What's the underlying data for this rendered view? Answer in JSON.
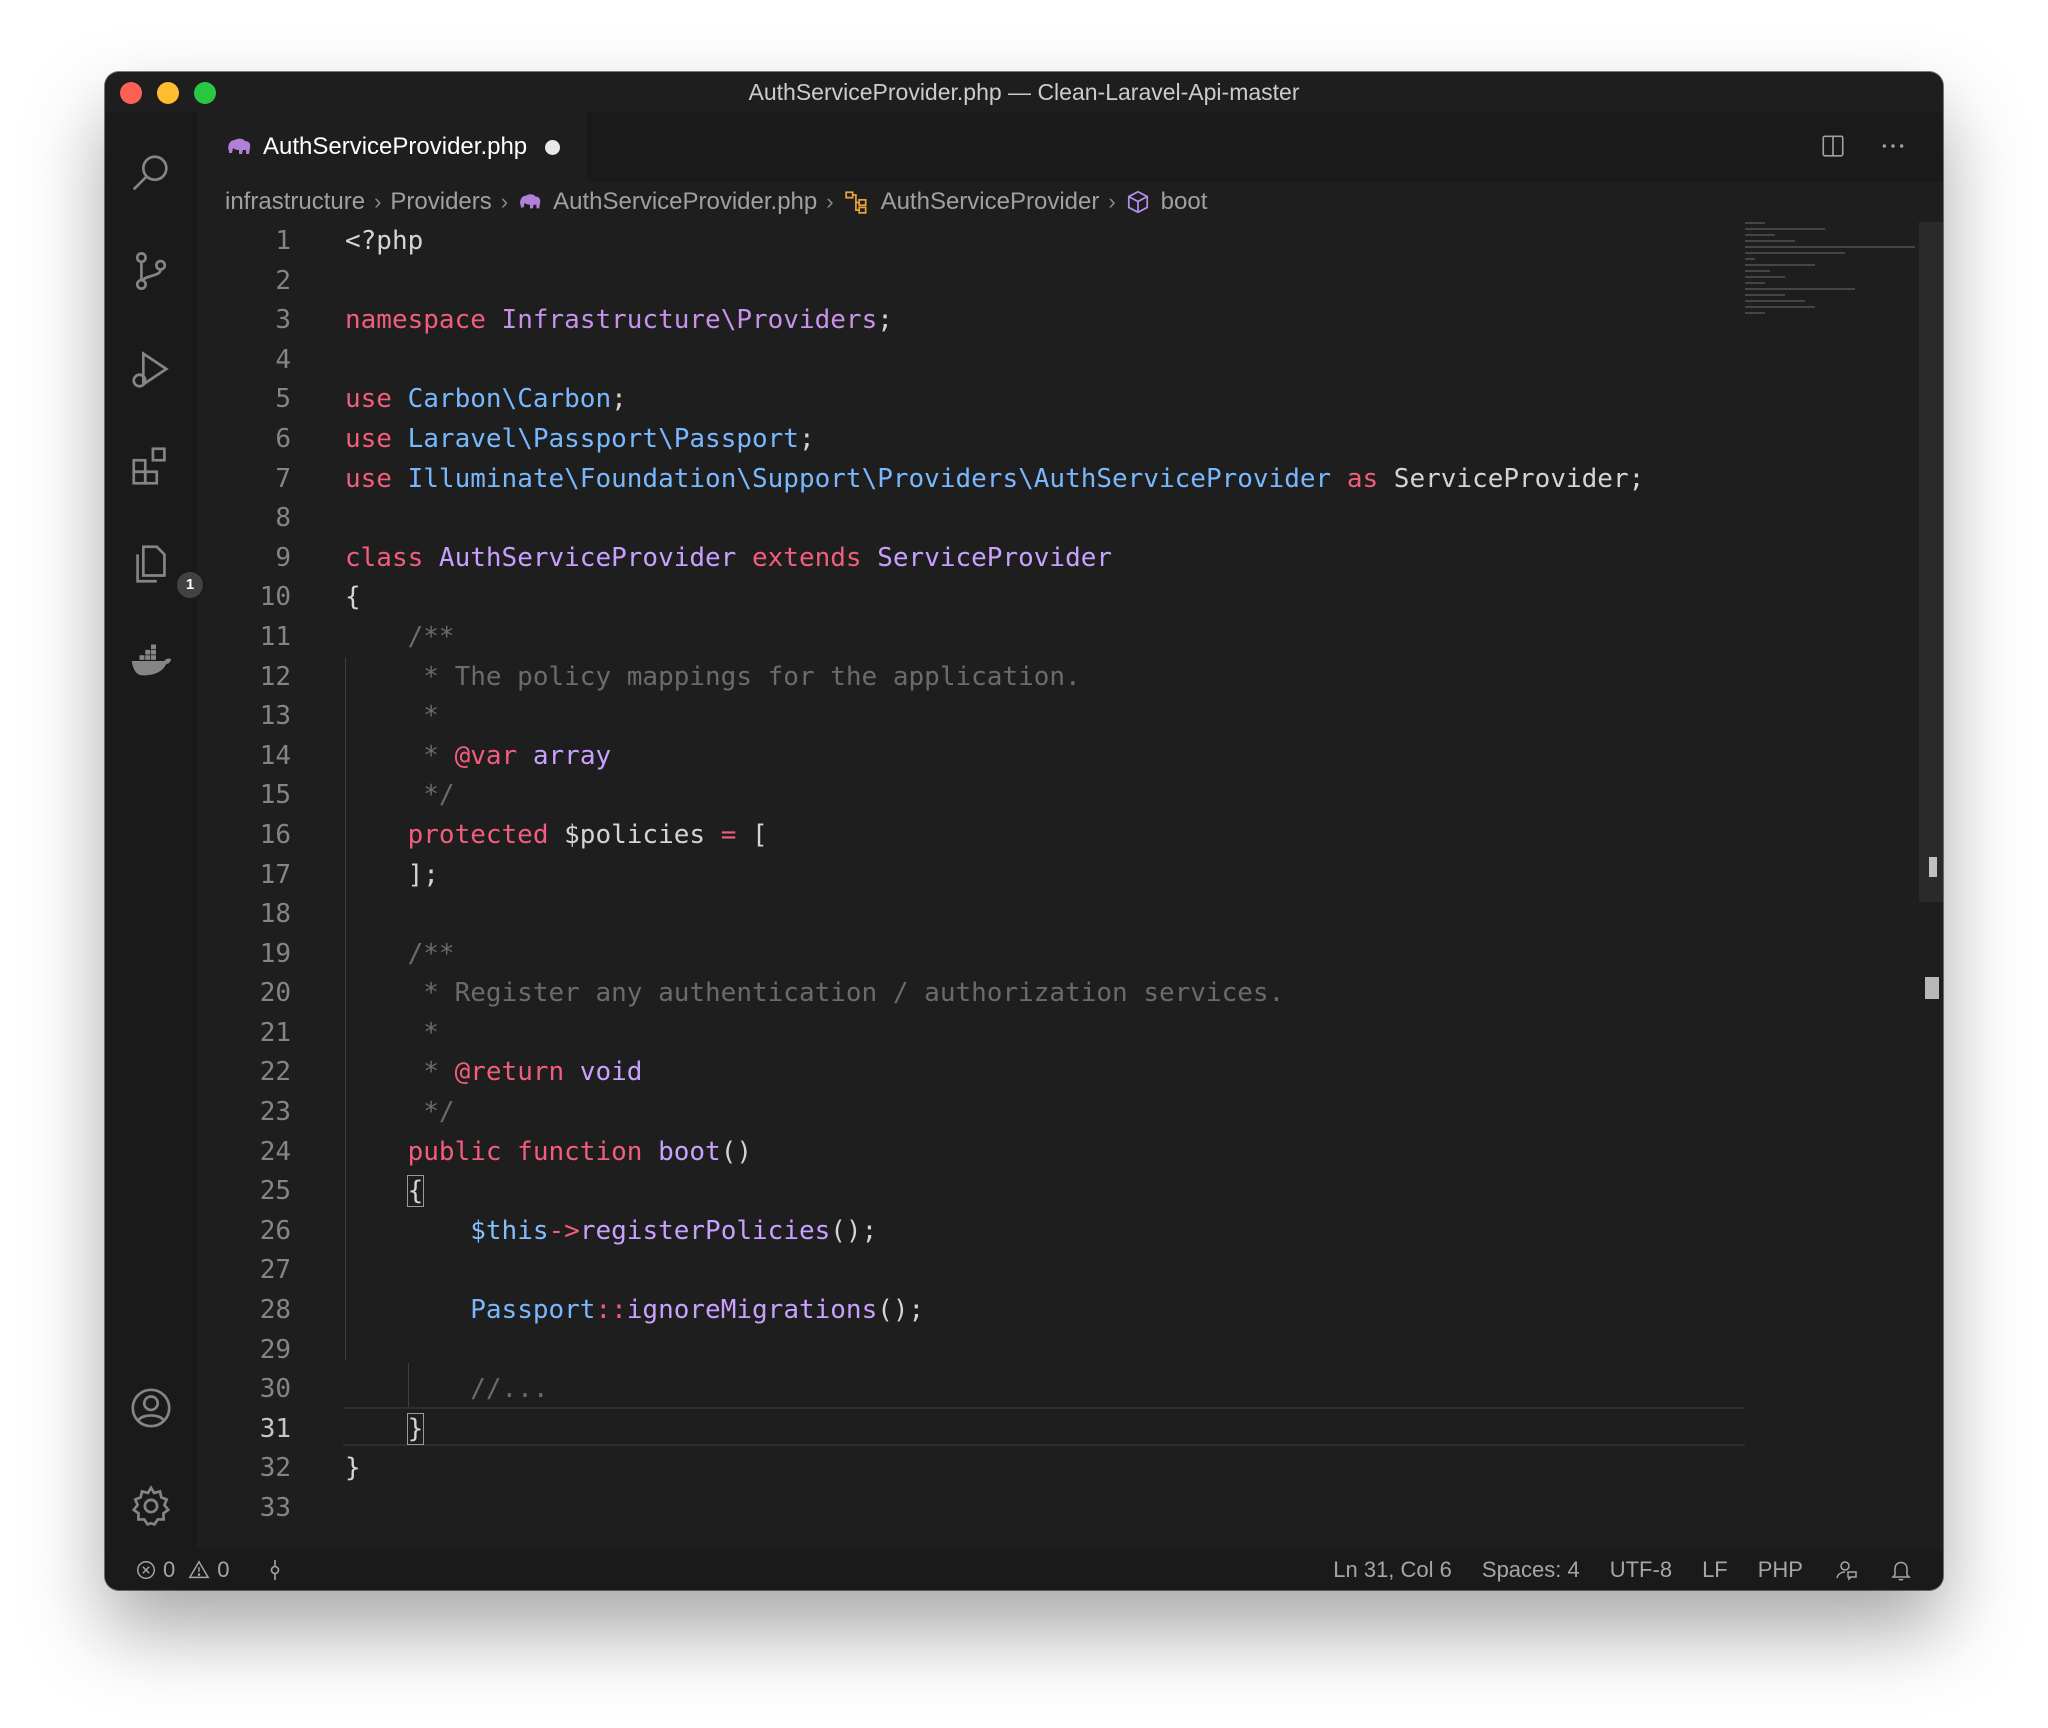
{
  "window": {
    "title": "AuthServiceProvider.php — Clean-Laravel-Api-master"
  },
  "activity_bar": {
    "icons": [
      "search-icon",
      "source-control-icon",
      "run-debug-icon",
      "extensions-icon",
      "explorer-icon",
      "docker-icon",
      "account-icon",
      "settings-gear-icon"
    ],
    "explorer_badge": "1"
  },
  "tab": {
    "label": "AuthServiceProvider.php",
    "modified": true
  },
  "breadcrumb": {
    "items": [
      "infrastructure",
      "Providers",
      "AuthServiceProvider.php",
      "AuthServiceProvider",
      "boot"
    ]
  },
  "editor": {
    "active_line": 31,
    "line_numbers": [
      "1",
      "2",
      "3",
      "4",
      "5",
      "6",
      "7",
      "8",
      "9",
      "10",
      "11",
      "12",
      "13",
      "14",
      "15",
      "16",
      "17",
      "18",
      "19",
      "20",
      "21",
      "22",
      "23",
      "24",
      "25",
      "26",
      "27",
      "28",
      "29",
      "30",
      "31",
      "32",
      "33"
    ],
    "lines": [
      "<?php",
      "",
      "namespace Infrastructure\\Providers;",
      "",
      "use Carbon\\Carbon;",
      "use Laravel\\Passport\\Passport;",
      "use Illuminate\\Foundation\\Support\\Providers\\AuthServiceProvider as ServiceProvider;",
      "",
      "class AuthServiceProvider extends ServiceProvider",
      "{",
      "    /**",
      "     * The policy mappings for the application.",
      "     *",
      "     * @var array",
      "     */",
      "    protected $policies = [",
      "    ];",
      "",
      "    /**",
      "     * Register any authentication / authorization services.",
      "     *",
      "     * @return void",
      "     */",
      "    public function boot()",
      "    {",
      "        $this->registerPolicies();",
      "",
      "        Passport::ignoreMigrations();",
      "",
      "        //...",
      "    }",
      "}",
      ""
    ]
  },
  "status_bar": {
    "errors": "0",
    "warnings": "0",
    "cursor": "Ln 31, Col 6",
    "indent": "Spaces: 4",
    "encoding": "UTF-8",
    "eol": "LF",
    "language": "PHP"
  },
  "colors": {
    "background": "#1e1e1e",
    "keyword": "#f25d7c",
    "class": "#c9a0ff",
    "type": "#78b8ff",
    "comment": "#6b6b6b"
  }
}
